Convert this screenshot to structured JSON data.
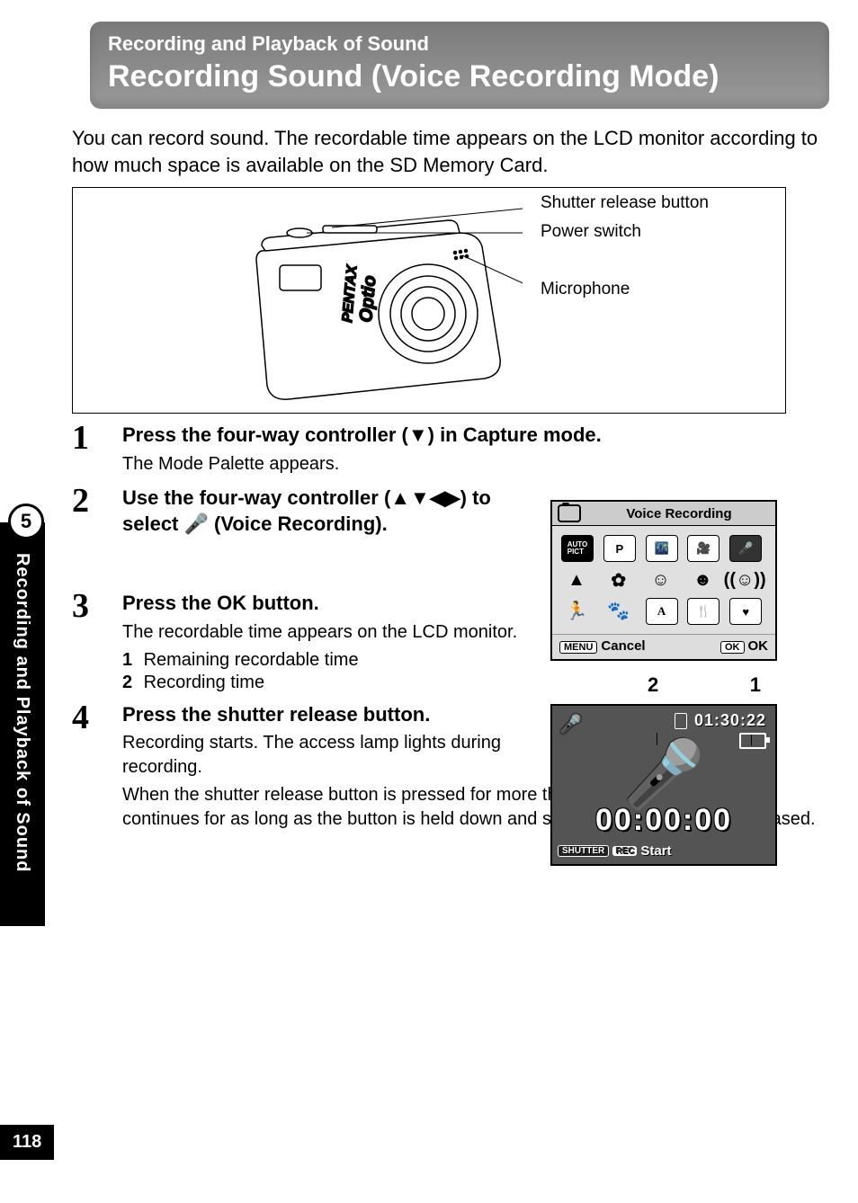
{
  "header": {
    "section": "Recording and Playback of Sound",
    "title": "Recording Sound (Voice Recording Mode)"
  },
  "intro": "You can record sound. The recordable time appears on the LCD monitor according to how much space is available on the SD Memory Card.",
  "diagram": {
    "callouts": {
      "shutter": "Shutter release button",
      "power": "Power switch",
      "mic": "Microphone"
    },
    "camera_brand": "PENTAX",
    "camera_model": "Optio"
  },
  "steps": [
    {
      "num": "1",
      "title": "Press the four-way controller (▼) in Capture mode.",
      "desc": "The Mode Palette appears."
    },
    {
      "num": "2",
      "title": "Use the four-way controller (▲▼◀▶) to select 🎤 (Voice Recording)."
    },
    {
      "num": "3",
      "title": "Press the OK button.",
      "desc": "The recordable time appears on the LCD monitor.",
      "sublist": [
        {
          "n": "1",
          "t": "Remaining recordable time"
        },
        {
          "n": "2",
          "t": "Recording time"
        }
      ]
    },
    {
      "num": "4",
      "title": "Press the shutter release button.",
      "desc": "Recording starts. The access lamp lights during recording.",
      "desc2": "When the shutter release button is pressed for more than one second, recording continues for as long as the button is held down and stops when the button is released."
    }
  ],
  "palette": {
    "title": "Voice Recording",
    "icons": [
      {
        "name": "auto-pict-icon",
        "label": "AUTO\nPICT"
      },
      {
        "name": "program-icon",
        "label": "P"
      },
      {
        "name": "night-scene-icon",
        "label": "🌃"
      },
      {
        "name": "movie-icon",
        "label": "🎥"
      },
      {
        "name": "voice-rec-icon",
        "label": "🎤",
        "selected": true
      },
      {
        "name": "landscape-icon",
        "label": "▲"
      },
      {
        "name": "flower-icon",
        "label": "✿"
      },
      {
        "name": "portrait-icon",
        "label": "☺"
      },
      {
        "name": "surf-snow-icon",
        "label": "☻"
      },
      {
        "name": "soft-icon",
        "label": "((☺))"
      },
      {
        "name": "sport-icon",
        "label": "🏃"
      },
      {
        "name": "pet-icon",
        "label": "🐾"
      },
      {
        "name": "text-icon",
        "label": "A"
      },
      {
        "name": "food-icon",
        "label": "🍴"
      },
      {
        "name": "frame-icon",
        "label": "♥"
      }
    ],
    "footer": {
      "menu_chip": "MENU",
      "cancel": "Cancel",
      "ok_chip": "OK",
      "ok": "OK"
    }
  },
  "lcd": {
    "label_2": "2",
    "label_1": "1",
    "remaining": "01:30:22",
    "recording_time": "00:00:00",
    "shutter_chip": "SHUTTER",
    "rec_chip": "REC",
    "start": "Start"
  },
  "side": {
    "chapter_num": "5",
    "chapter_label": "Recording and Playback of Sound"
  },
  "page_number": "118"
}
